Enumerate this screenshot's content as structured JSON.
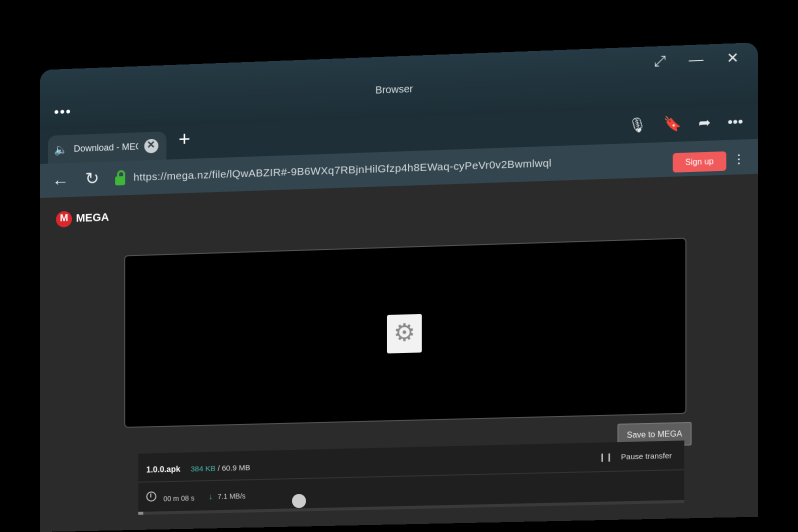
{
  "window": {
    "title": "Browser"
  },
  "tab": {
    "title": "Download - MEGA"
  },
  "address": {
    "url": "https://mega.nz/file/lQwABZIR#-9B6WXq7RBjnHilGfzp4h8EWaq-cyPeVr0v2Bwmlwql"
  },
  "page": {
    "signup_label": "Sign up",
    "logo_text": "MEGA",
    "save_label": "Save to MEGA",
    "file_name": "1.0.0.apk",
    "downloaded": "384 KB",
    "separator": "/",
    "total": "60.9 MB",
    "pause_label": "Pause transfer",
    "eta": "00 m 08 s",
    "speed": "7.1 MB/s",
    "progress_fraction": 0.01
  },
  "icons": {
    "window_menu": "dots-icon",
    "maximize": "expand-icon",
    "minimize": "minimize-icon",
    "close": "close-icon",
    "mic": "mic-icon",
    "bookmark": "bookmark-icon",
    "share": "share-icon",
    "more": "more-icon",
    "back": "back-arrow-icon",
    "reload": "reload-icon",
    "lock": "lock-icon",
    "gear": "gear-icon"
  },
  "colors": {
    "accent_red": "#f15a5a",
    "mega_red": "#d9272e",
    "progress_teal": "#42b8a8",
    "lock_green": "#3fb53a"
  }
}
